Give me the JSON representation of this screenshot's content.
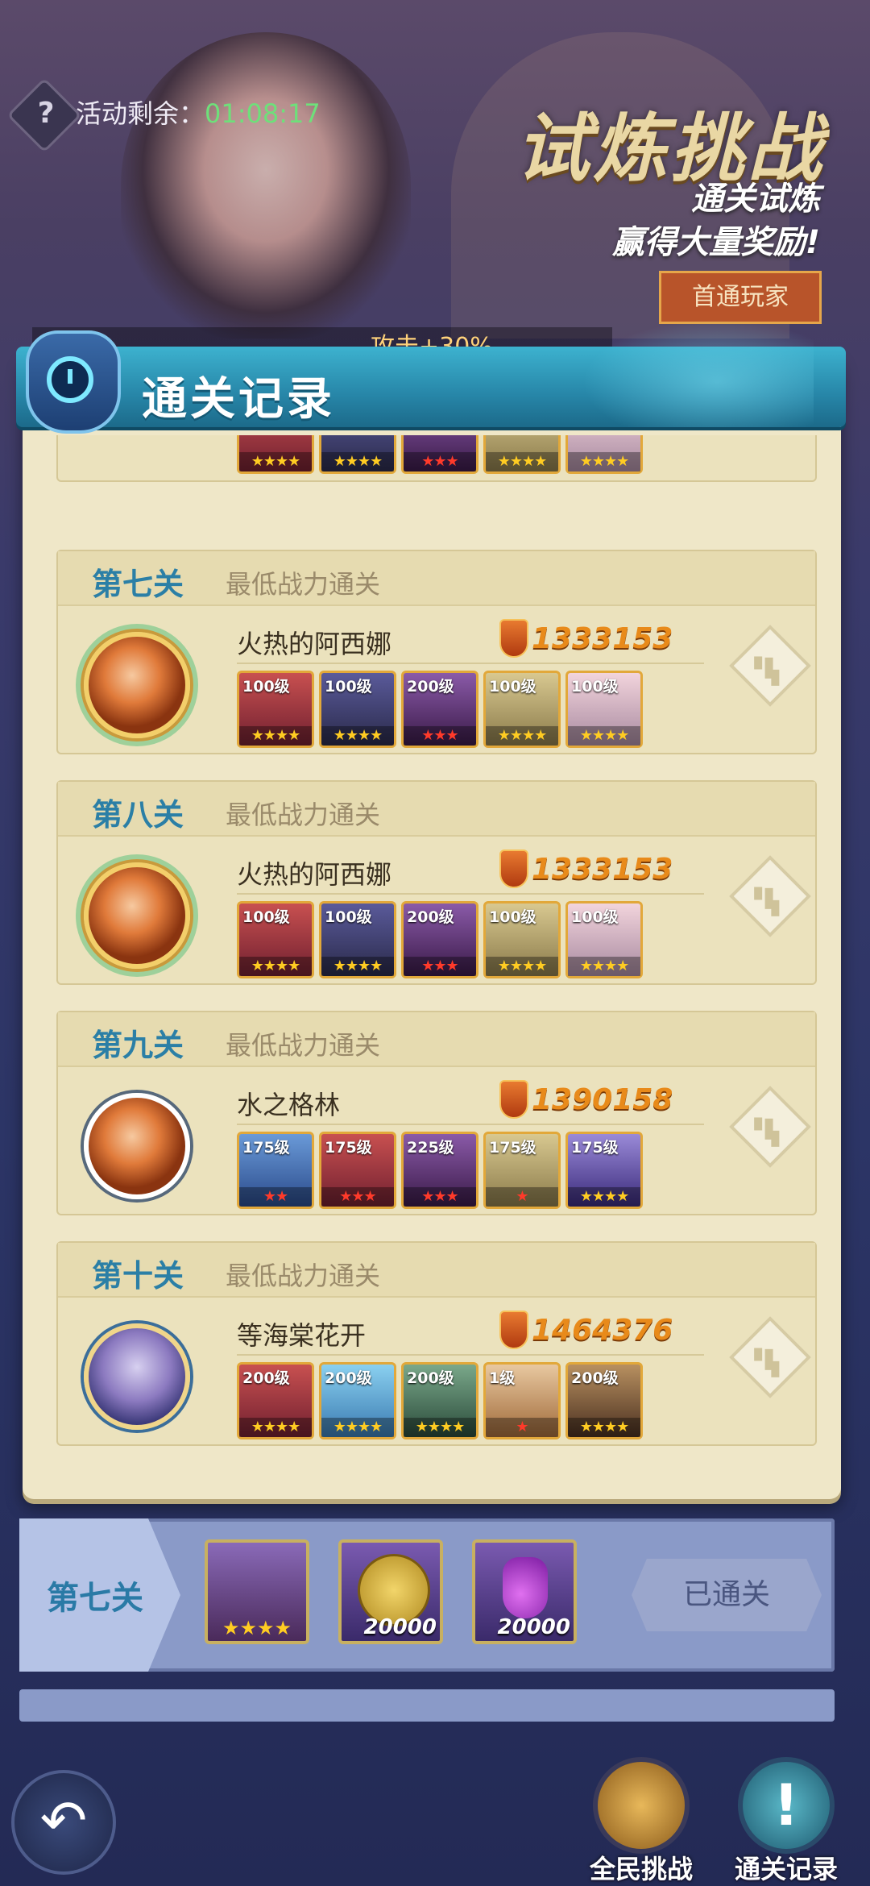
{
  "header": {
    "help_icon": "question-icon",
    "countdown_label": "活动剩余：",
    "countdown_value": "01:08:17",
    "title": "试炼挑战",
    "subtitle_line1": "通关试炼",
    "subtitle_line2": "赢得大量奖励!",
    "first_clear_label": "首通玩家",
    "buff_text": "攻击+30%"
  },
  "panel": {
    "title": "通关记录",
    "title_icon": "clock-icon"
  },
  "stages": [
    {
      "name": "第七关",
      "note": "最低战力通关",
      "player": "火热的阿西娜",
      "power": "1333153",
      "heroes": [
        {
          "level": "100级",
          "stars": "★★★★"
        },
        {
          "level": "100级",
          "stars": "★★★★"
        },
        {
          "level": "200级",
          "stars": "★★★"
        },
        {
          "level": "100级",
          "stars": "★★★★"
        },
        {
          "level": "100级",
          "stars": "★★★★"
        }
      ]
    },
    {
      "name": "第八关",
      "note": "最低战力通关",
      "player": "火热的阿西娜",
      "power": "1333153",
      "heroes": [
        {
          "level": "100级",
          "stars": "★★★★"
        },
        {
          "level": "100级",
          "stars": "★★★★"
        },
        {
          "level": "200级",
          "stars": "★★★"
        },
        {
          "level": "100级",
          "stars": "★★★★"
        },
        {
          "level": "100级",
          "stars": "★★★★"
        }
      ]
    },
    {
      "name": "第九关",
      "note": "最低战力通关",
      "player": "水之格林",
      "power": "1390158",
      "heroes": [
        {
          "level": "175级",
          "stars": "★★"
        },
        {
          "level": "175级",
          "stars": "★★★"
        },
        {
          "level": "225级",
          "stars": "★★★"
        },
        {
          "level": "175级",
          "stars": "★"
        },
        {
          "level": "175级",
          "stars": "★★★★"
        }
      ]
    },
    {
      "name": "第十关",
      "note": "最低战力通关",
      "player": "等海棠花开",
      "power": "1464376",
      "heroes": [
        {
          "level": "200级",
          "stars": "★★★★"
        },
        {
          "level": "200级",
          "stars": "★★★★"
        },
        {
          "level": "200级",
          "stars": "★★★★"
        },
        {
          "level": "1级",
          "stars": "★"
        },
        {
          "level": "200级",
          "stars": "★★★★"
        }
      ]
    }
  ],
  "partial_stage": {
    "heroes_stars": [
      "★★★★",
      "★★★★",
      "★★★",
      "★★★★",
      "★★★★"
    ]
  },
  "reward_row": {
    "stage": "第七关",
    "hero_stars": "★★★★",
    "coin_amount": "20000",
    "potion_amount": "20000",
    "status": "已通关"
  },
  "nav": {
    "back_icon": "back-arrow-icon",
    "all_challenge_label": "全民挑战",
    "record_label": "通关记录"
  }
}
